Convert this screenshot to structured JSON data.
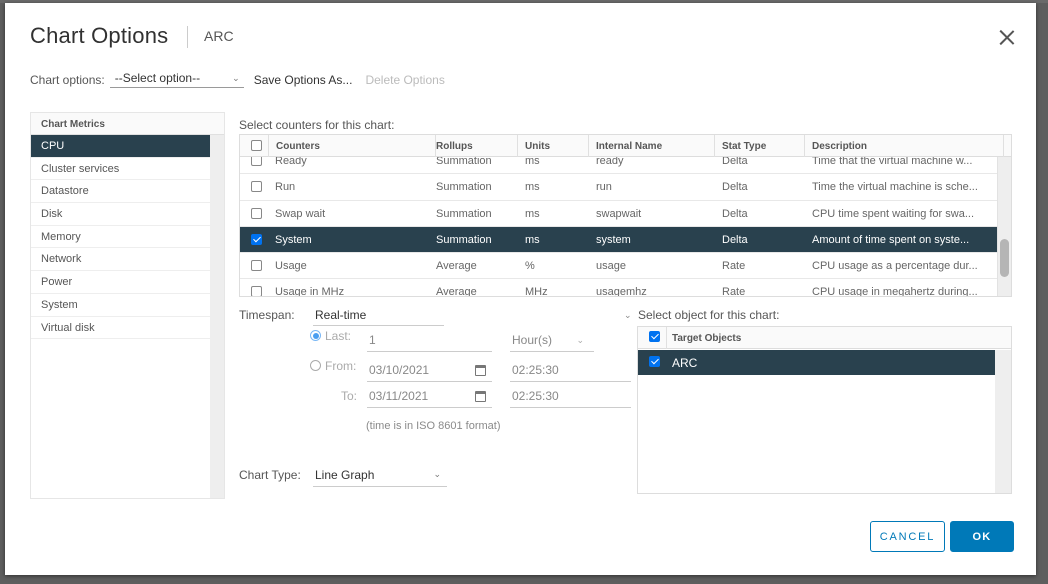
{
  "dialog": {
    "title": "Chart Options",
    "subtitle": "ARC",
    "close_icon": "close-icon"
  },
  "chart_options": {
    "label": "Chart options:",
    "selected": "--Select option--",
    "save_label": "Save Options As...",
    "delete_label": "Delete Options"
  },
  "metrics": {
    "header": "Chart Metrics",
    "items": [
      {
        "label": "CPU",
        "selected": true
      },
      {
        "label": "Cluster services",
        "selected": false
      },
      {
        "label": "Datastore",
        "selected": false
      },
      {
        "label": "Disk",
        "selected": false
      },
      {
        "label": "Memory",
        "selected": false
      },
      {
        "label": "Network",
        "selected": false
      },
      {
        "label": "Power",
        "selected": false
      },
      {
        "label": "System",
        "selected": false
      },
      {
        "label": "Virtual disk",
        "selected": false
      }
    ]
  },
  "counters": {
    "label": "Select counters for this chart:",
    "columns": [
      "Counters",
      "Rollups",
      "Units",
      "Internal Name",
      "Stat Type",
      "Description"
    ],
    "rows": [
      {
        "checked": false,
        "selected": false,
        "cells": [
          "Ready",
          "Summation",
          "ms",
          "ready",
          "Delta",
          "Time that the virtual machine w..."
        ]
      },
      {
        "checked": false,
        "selected": false,
        "cells": [
          "Run",
          "Summation",
          "ms",
          "run",
          "Delta",
          "Time the virtual machine is sche..."
        ]
      },
      {
        "checked": false,
        "selected": false,
        "cells": [
          "Swap wait",
          "Summation",
          "ms",
          "swapwait",
          "Delta",
          "CPU time spent waiting for swa..."
        ]
      },
      {
        "checked": true,
        "selected": true,
        "cells": [
          "System",
          "Summation",
          "ms",
          "system",
          "Delta",
          "Amount of time spent on syste..."
        ]
      },
      {
        "checked": false,
        "selected": false,
        "cells": [
          "Usage",
          "Average",
          "%",
          "usage",
          "Rate",
          "CPU usage as a percentage dur..."
        ]
      },
      {
        "checked": false,
        "selected": false,
        "cells": [
          "Usage in MHz",
          "Average",
          "MHz",
          "usagemhz",
          "Rate",
          "CPU usage in megahertz during..."
        ]
      }
    ]
  },
  "timespan": {
    "label": "Timespan:",
    "selected": "Real-time",
    "last_label": "Last:",
    "last_value": "1",
    "last_unit": "Hour(s)",
    "from_label": "From:",
    "from_date": "03/10/2021",
    "from_time": "02:25:30",
    "to_label": "To:",
    "to_date": "03/11/2021",
    "to_time": "02:25:30",
    "mode": "last",
    "note": "(time is in ISO 8601 format)"
  },
  "chart_type": {
    "label": "Chart Type:",
    "selected": "Line Graph"
  },
  "objects": {
    "label": "Select object for this chart:",
    "header": "Target Objects",
    "header_checked": true,
    "rows": [
      {
        "label": "ARC",
        "checked": true,
        "selected": true
      }
    ]
  },
  "buttons": {
    "cancel": "CANCEL",
    "ok": "OK"
  },
  "colors": {
    "selected_row": "#29414e",
    "primary": "#0079b8",
    "checkbox": "#0072f0"
  }
}
